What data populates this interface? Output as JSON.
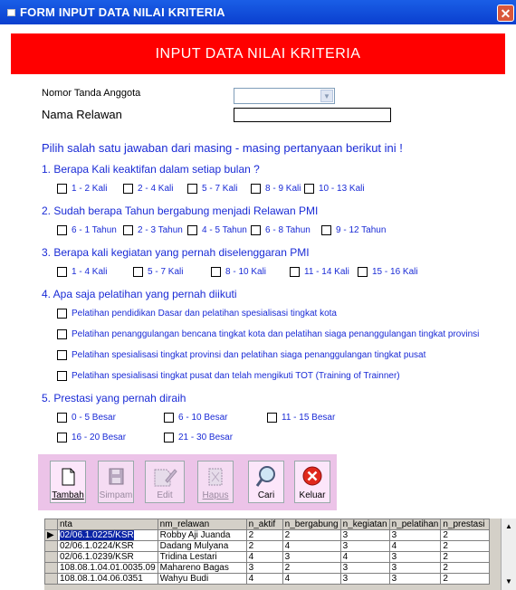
{
  "window": {
    "title": "FORM INPUT DATA NILAI KRITERIA",
    "close": "✕"
  },
  "header": {
    "title": "INPUT DATA NILAI KRITERIA"
  },
  "fields": {
    "nomor_label": "Nomor Tanda Anggota",
    "nama_label": "Nama Relawan",
    "nomor_value": "",
    "nama_value": ""
  },
  "instruction": "Pilih salah satu jawaban dari masing - masing pertanyaan berikut ini  !",
  "questions": [
    {
      "text": "1. Berapa Kali keaktifan dalam setiap bulan ?",
      "options": [
        "1 - 2 Kali",
        "2 - 4 Kali",
        "5 - 7 Kali",
        "8 - 9 Kali",
        "10 - 13 Kali"
      ]
    },
    {
      "text": "2. Sudah berapa Tahun bergabung menjadi Relawan PMI",
      "options": [
        "6 - 1 Tahun",
        "2 - 3 Tahun",
        "4 - 5 Tahun",
        "6 - 8 Tahun",
        "9 - 12 Tahun"
      ]
    },
    {
      "text": "3. Berapa kali kegiatan yang pernah diselenggaran PMI",
      "options": [
        "1 - 4 Kali",
        "5 - 7 Kali",
        "8 - 10 Kali",
        "11 - 14 Kali",
        "15 - 16 Kali"
      ]
    },
    {
      "text": "4. Apa saja pelatihan yang pernah diikuti",
      "options": [
        "Pelatihan pendidikan Dasar dan pelatihan spesialisasi tingkat kota",
        "Pelatihan penanggulangan bencana tingkat kota dan pelatihan siaga penanggulangan tingkat provinsi",
        "Pelatihan spesialisasi tingkat provinsi dan pelatihan siaga penanggulangan tingkat pusat",
        "Pelatihan spesialisasi tingkat pusat dan telah mengikuti TOT (Training of Trainner)"
      ]
    },
    {
      "text": "5. Prestasi yang pernah diraih",
      "options": [
        "0 - 5 Besar",
        "6 - 10 Besar",
        "11 - 15 Besar",
        "16 - 20 Besar",
        "21 - 30 Besar"
      ]
    }
  ],
  "toolbar": {
    "tambah": "Tambah",
    "simpan": "Simpam",
    "edit": "Edit",
    "hapus": "Hapus",
    "cari": "Cari",
    "keluar": "Keluar"
  },
  "grid": {
    "columns": [
      "nta",
      "nm_relawan",
      "n_aktif",
      "n_bergabung",
      "n_kegiatan",
      "n_pelatihan",
      "n_prestasi"
    ],
    "rows": [
      {
        "nta": "02/06.1.0225/KSR",
        "nama": "Robby Aji Juanda",
        "aktif": "2",
        "bergabung": "2",
        "kegiatan": "3",
        "pelatihan": "3",
        "prestasi": "2"
      },
      {
        "nta": "02/06.1.0224/KSR",
        "nama": "Dadang Mulyana",
        "aktif": "2",
        "bergabung": "4",
        "kegiatan": "3",
        "pelatihan": "4",
        "prestasi": "2"
      },
      {
        "nta": "02/06.1.0239/KSR",
        "nama": "Tridina Lestari",
        "aktif": "4",
        "bergabung": "3",
        "kegiatan": "4",
        "pelatihan": "3",
        "prestasi": "2"
      },
      {
        "nta": "108.08.1.04.01.0035.09",
        "nama": "Mahareno Bagas",
        "aktif": "3",
        "bergabung": "2",
        "kegiatan": "3",
        "pelatihan": "3",
        "prestasi": "2"
      },
      {
        "nta": "108.08.1.04.06.0351",
        "nama": "Wahyu Budi",
        "aktif": "4",
        "bergabung": "4",
        "kegiatan": "3",
        "pelatihan": "3",
        "prestasi": "2"
      }
    ]
  }
}
